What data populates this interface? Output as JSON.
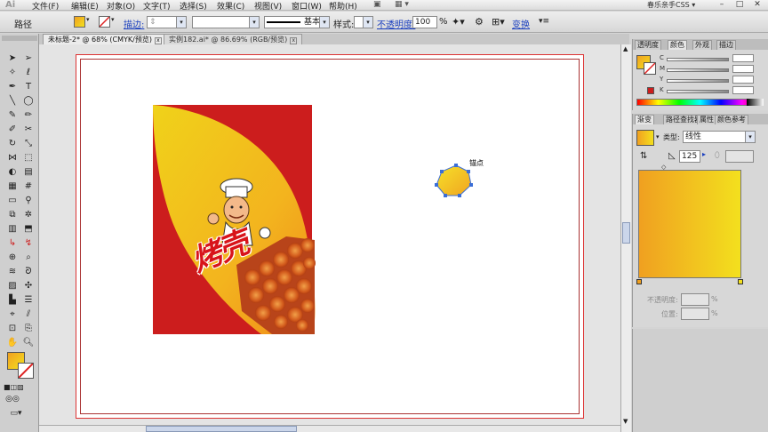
{
  "menubar": {
    "logo": "Ai",
    "items": [
      "文件(F)",
      "编辑(E)",
      "对象(O)",
      "文字(T)",
      "选择(S)",
      "效果(C)",
      "视图(V)",
      "窗口(W)",
      "帮助(H)"
    ],
    "workspace": "春乐亲手CSS ▾"
  },
  "control": {
    "object_type": "路径",
    "stroke_label": "描边:",
    "style_label": "样式:",
    "brush_value": "基本",
    "opacity_label": "不透明度:",
    "opacity_value": "100",
    "opacity_unit": "%",
    "transform_label": "变换"
  },
  "tabs": [
    {
      "label": "未标题-2* @ 68% (CMYK/预览)",
      "active": true
    },
    {
      "label": "实例182.ai* @ 86.69% (RGB/预览)",
      "active": false
    }
  ],
  "canvas": {
    "anchor_label": "锚点",
    "product_text": "烤壳"
  },
  "colors": {
    "accent_red": "#cc1d1d",
    "yellow": "#f3d41e",
    "orange": "#f0a020"
  },
  "color_panel": {
    "tabs": [
      "透明度",
      "颜色",
      "外观",
      "描边"
    ],
    "sliders": [
      "C",
      "M",
      "Y",
      "K"
    ]
  },
  "gradient_panel": {
    "tabs": [
      "渐变",
      "路径查找器",
      "属性",
      "颜色参考"
    ],
    "type_label": "类型:",
    "type_value": "线性",
    "angle_value": "125",
    "opacity_label": "不透明度:",
    "opacity_unit": "%",
    "position_label": "位置:",
    "position_unit": "%"
  }
}
